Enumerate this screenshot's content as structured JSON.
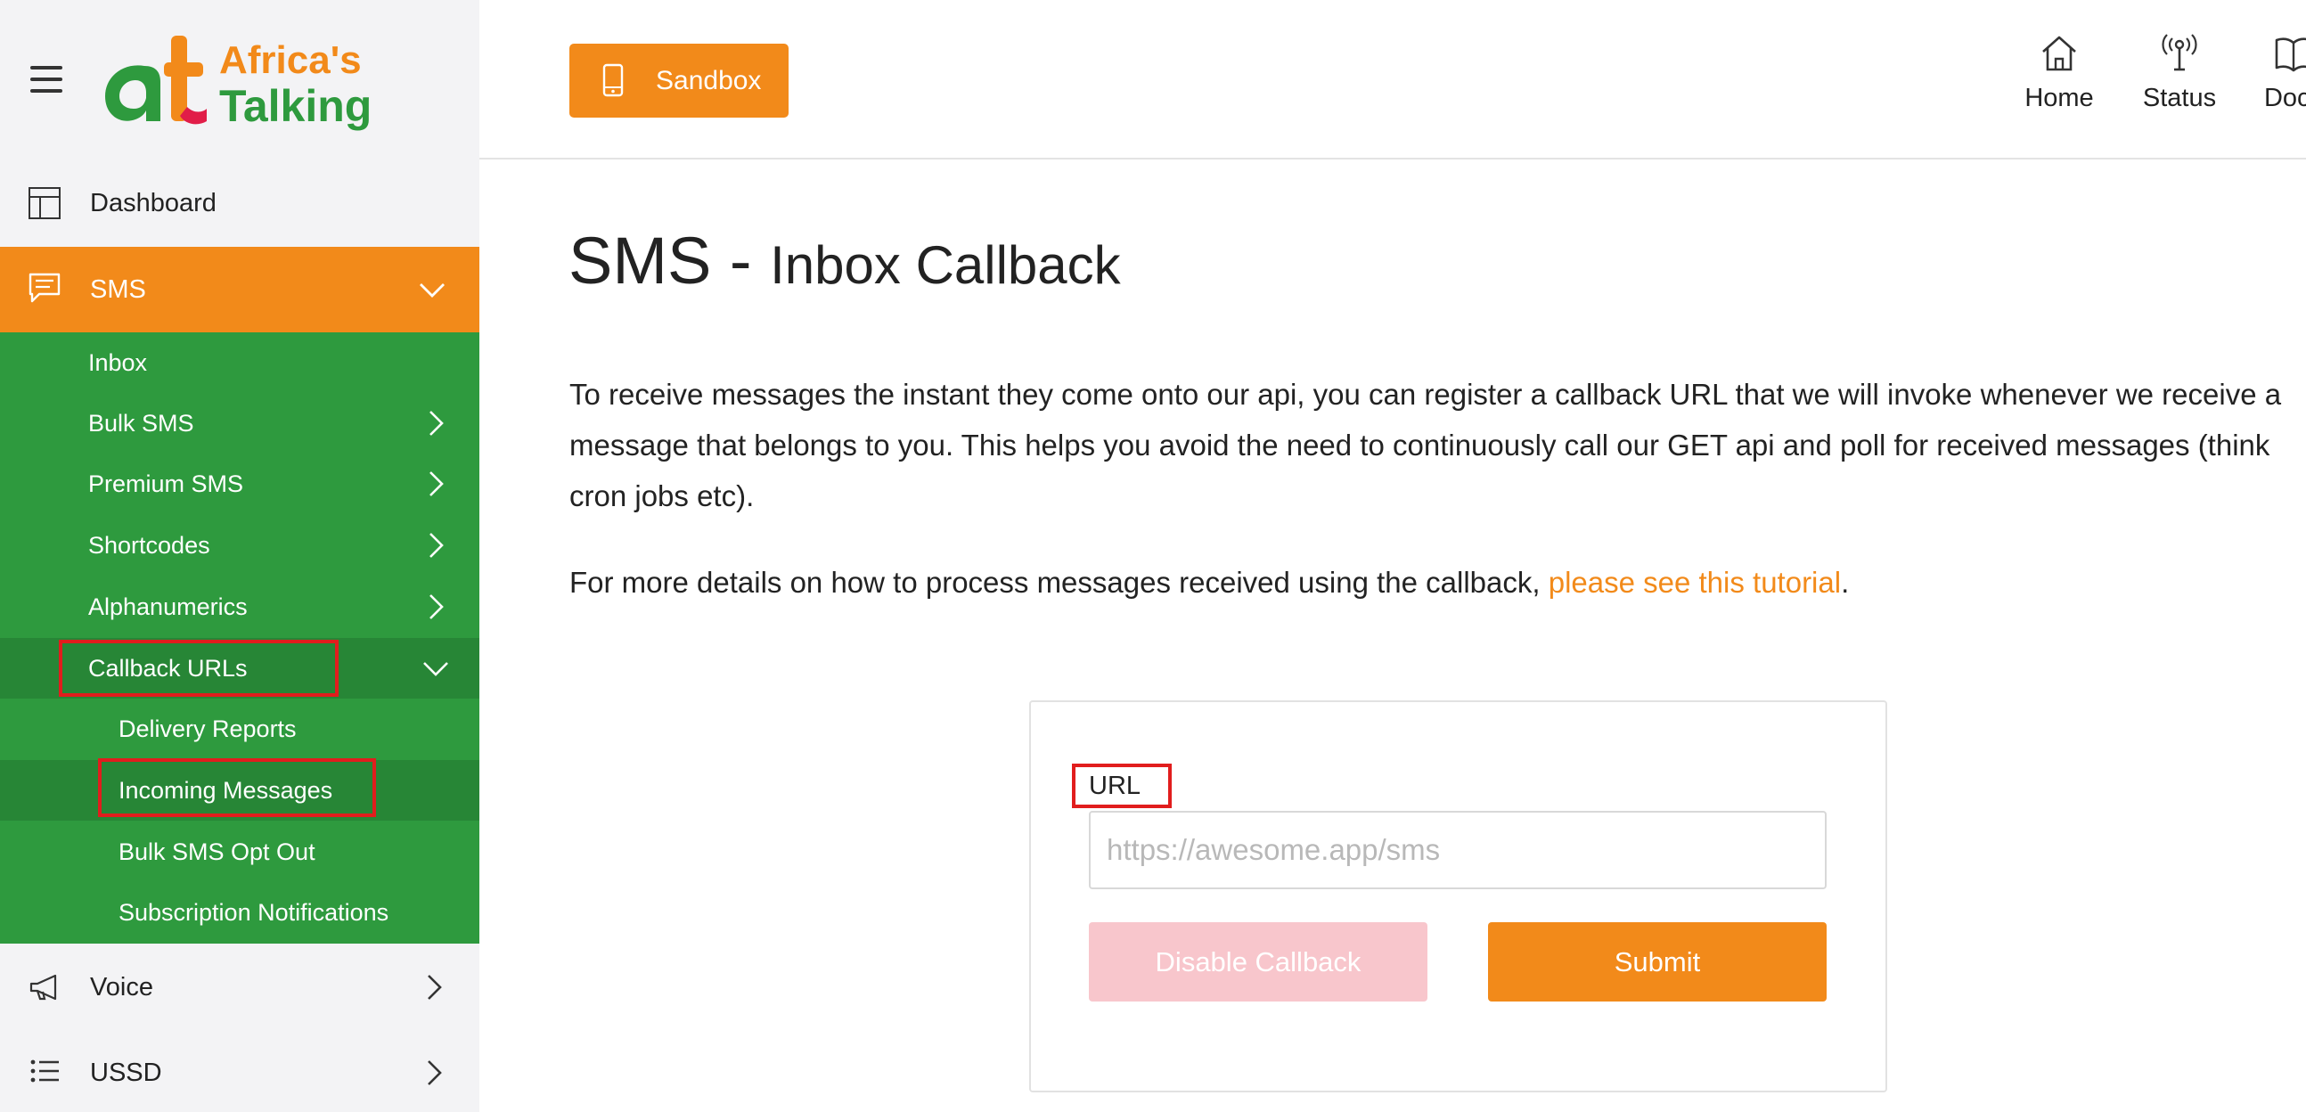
{
  "brand": {
    "logo_line1": "Africa's",
    "logo_line2": "Talking",
    "logo_mark": "at"
  },
  "sidebar": {
    "dashboard_label": "Dashboard",
    "sms_label": "SMS",
    "sms_items": {
      "inbox": "Inbox",
      "bulk_sms": "Bulk SMS",
      "premium_sms": "Premium SMS",
      "shortcodes": "Shortcodes",
      "alphanumerics": "Alphanumerics",
      "callback_urls": "Callback URLs",
      "delivery_reports": "Delivery Reports",
      "incoming_messages": "Incoming Messages",
      "bulk_sms_opt_out": "Bulk SMS Opt Out",
      "subscription_notifications": "Subscription Notifications"
    },
    "voice_label": "Voice",
    "ussd_label": "USSD"
  },
  "topbar": {
    "sandbox_label": "Sandbox",
    "home_label": "Home",
    "status_label": "Status",
    "docs_label": "Docs"
  },
  "main": {
    "title": "SMS -",
    "subtitle": "Inbox Callback",
    "intro": "To receive messages the instant they come onto our api, you can register a callback URL that we will invoke whenever we receive a message that belongs to you. This helps you avoid the need to continuously call our GET api and poll for received messages (think cron jobs etc).",
    "more_prefix": "For more details on how to process messages received using the callback,",
    "more_link": "please see this tutorial",
    "more_suffix": "."
  },
  "form": {
    "url_label": "URL",
    "url_placeholder": "https://awesome.app/sms",
    "url_value": "",
    "disable_label": "Disable Callback",
    "submit_label": "Submit"
  },
  "colors": {
    "accent_orange": "#f28a1a",
    "sidebar_green": "#2e9a3e",
    "sidebar_green_dark": "#278636",
    "highlight_red": "#e11d1d",
    "disabled_pink": "#f8c6cc"
  },
  "icons": {
    "menu": "hamburger-icon",
    "dashboard": "dashboard-icon",
    "sms": "chat-icon",
    "voice": "megaphone-icon",
    "ussd": "list-icon",
    "sandbox": "phone-icon",
    "home": "home-icon",
    "status": "antenna-icon",
    "docs": "book-icon"
  }
}
